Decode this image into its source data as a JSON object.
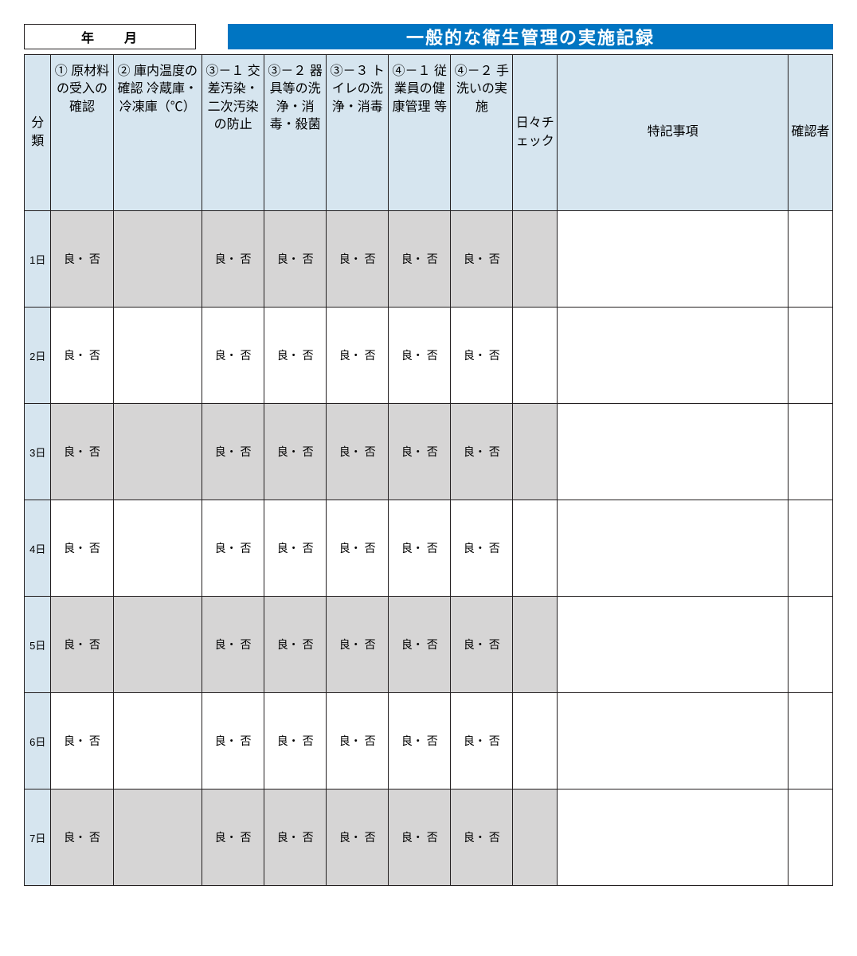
{
  "header": {
    "yearMonthLabel": "年　　月",
    "title": "一般的な衛生管理の実施記録"
  },
  "columns": {
    "category": "分類",
    "c1": "①\n原材料の受入の確認",
    "c2": "②\n庫内温度の確認\n冷蔵庫・冷凍庫（℃）",
    "c3_1": "③－１\n交差汚染・二次汚染の防止",
    "c3_2": "③－２\n器具等の洗浄・消毒・殺菌",
    "c3_3": "③－３\nトイレの洗浄・消毒",
    "c4_1": "④－１\n従業員の健康管理 等",
    "c4_2": "④－２\n手洗いの実施",
    "dailyCheck": "日々チェック",
    "notes": "特記事項",
    "confirmer": "確認者"
  },
  "cellText": "良・ 否",
  "days": [
    {
      "label": "1日"
    },
    {
      "label": "2日"
    },
    {
      "label": "3日"
    },
    {
      "label": "4日"
    },
    {
      "label": "5日"
    },
    {
      "label": "6日"
    },
    {
      "label": "7日"
    }
  ]
}
